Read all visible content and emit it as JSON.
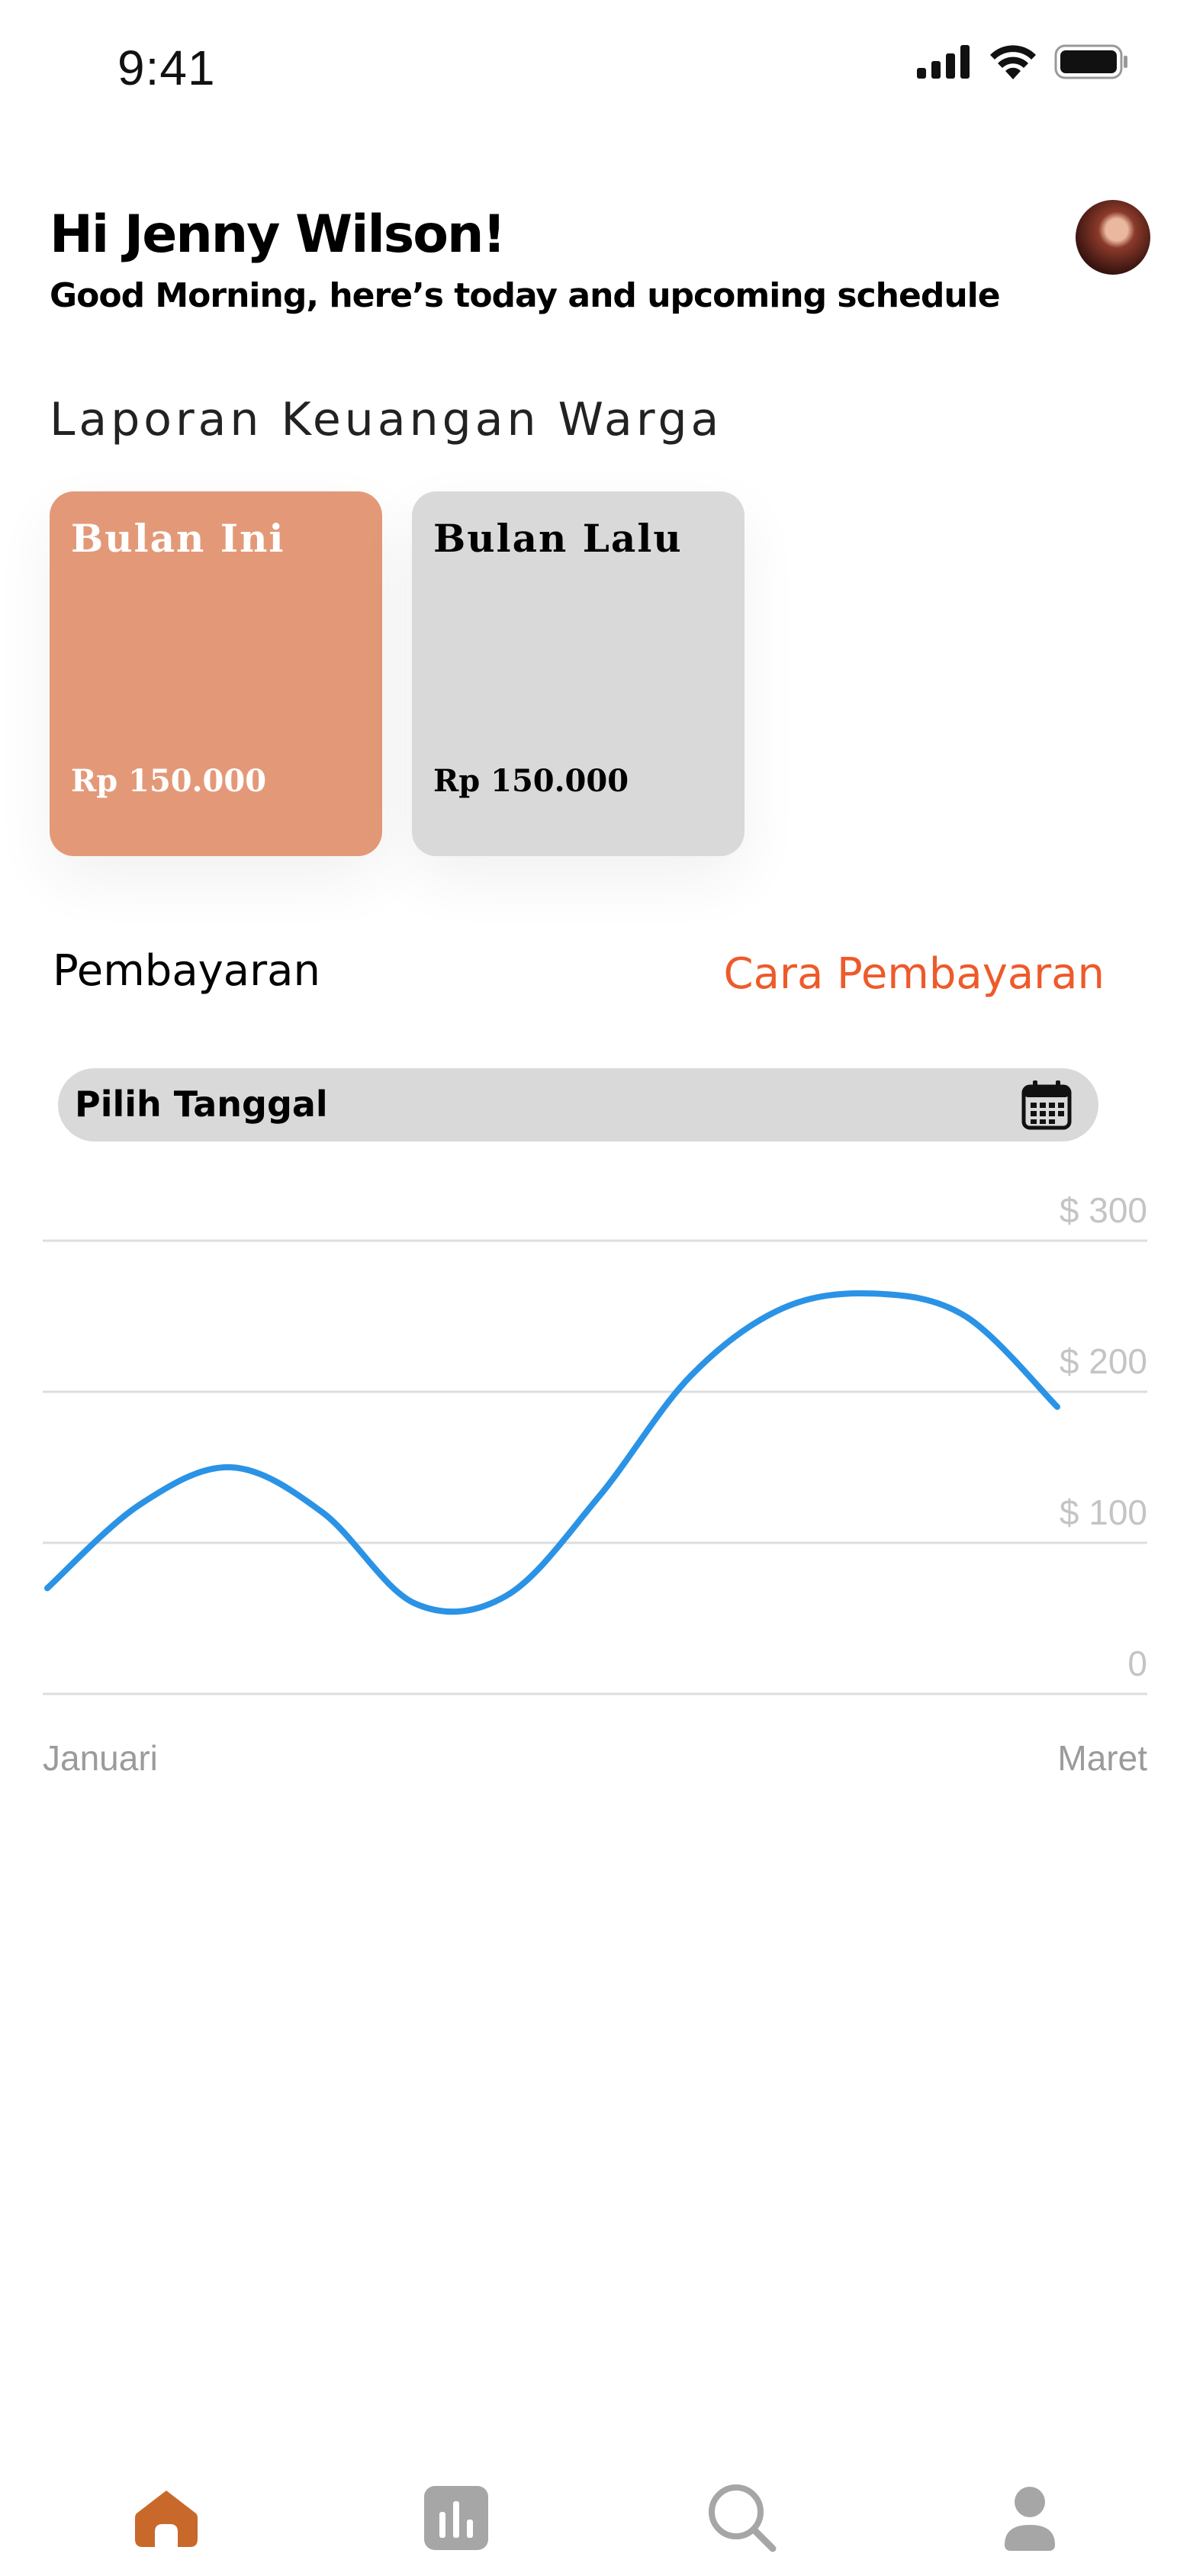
{
  "status_bar": {
    "time": "9:41"
  },
  "header": {
    "greeting": "Hi Jenny Wilson!",
    "subtitle": "Good Morning, here’s today and upcoming schedule"
  },
  "section_title": "Laporan Keuangan Warga",
  "cards": [
    {
      "label": "Bulan Ini",
      "amount": "Rp 150.000",
      "color": "#e39978"
    },
    {
      "label": "Bulan Lalu",
      "amount": "Rp 150.000",
      "color": "#d9d9d9"
    }
  ],
  "payment": {
    "title": "Pembayaran",
    "link": "Cara Pembayaran",
    "link_color": "#ee5a2b"
  },
  "date_picker": {
    "label": "Pilih Tanggal",
    "icon": "calendar-icon"
  },
  "chart_data": {
    "type": "line",
    "x_labels": [
      "Januari",
      "Maret"
    ],
    "y_ticks": [
      "$ 300",
      "$ 200",
      "$ 100",
      "0"
    ],
    "ylim": [
      0,
      300
    ],
    "grid": true,
    "series": [
      {
        "color": "#2a93e6",
        "values": [
          70,
          125,
          150,
          120,
          60,
          65,
          130,
          210,
          255,
          265,
          250,
          190
        ]
      }
    ]
  },
  "bottom_nav": [
    {
      "name": "home",
      "icon": "home-icon",
      "active": true
    },
    {
      "name": "stats",
      "icon": "bar-chart-icon",
      "active": false
    },
    {
      "name": "search",
      "icon": "search-icon",
      "active": false
    },
    {
      "name": "profile",
      "icon": "profile-icon",
      "active": false
    }
  ],
  "colors": {
    "accent": "#c8692b",
    "nav_inactive": "#a6a6a6"
  }
}
